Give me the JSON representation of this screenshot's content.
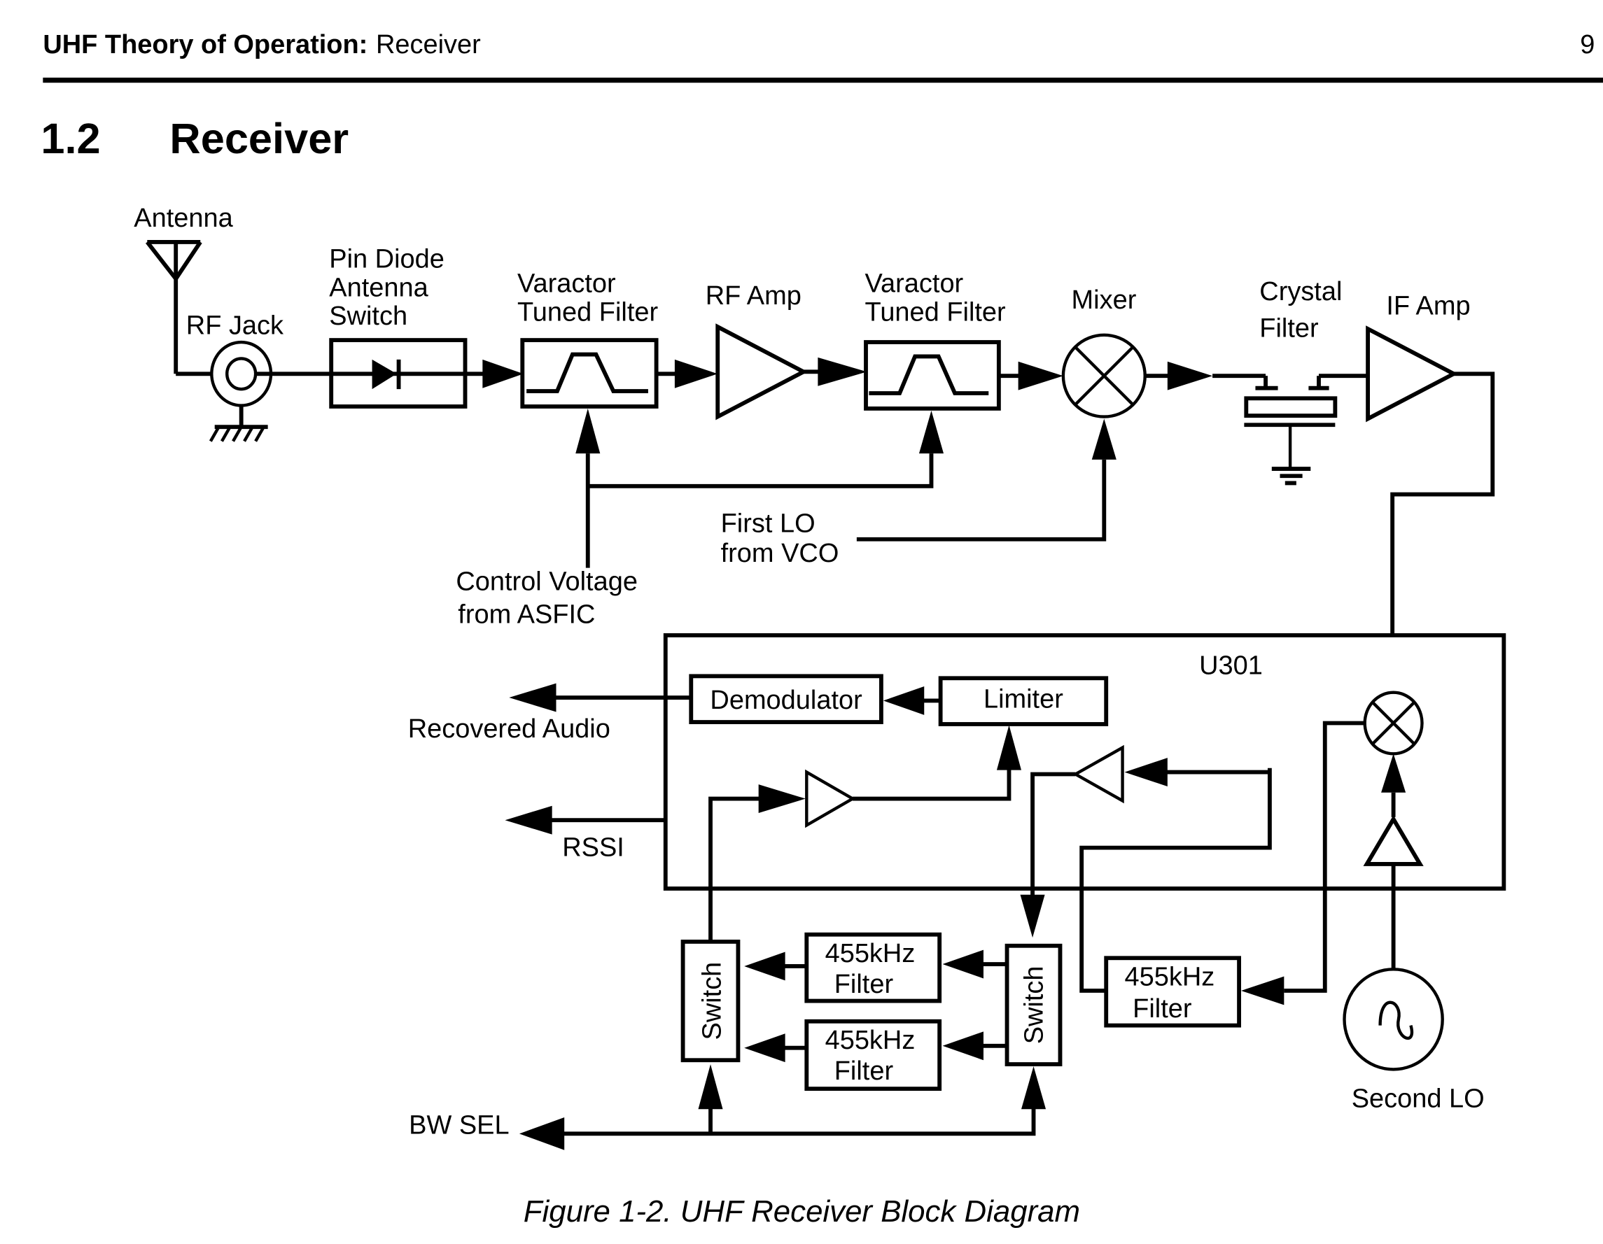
{
  "header": {
    "section_label": "UHF Theory of Operation:",
    "section_name": "Receiver",
    "page_number": "9"
  },
  "section": {
    "number": "1.2",
    "title": "Receiver"
  },
  "diagram": {
    "antenna": "Antenna",
    "rf_jack": "RF Jack",
    "pin_diode": [
      "Pin Diode",
      "Antenna",
      "Switch"
    ],
    "varactor1": [
      "Varactor",
      "Tuned Filter"
    ],
    "rf_amp": "RF Amp",
    "varactor2": [
      "Varactor",
      "Tuned Filter"
    ],
    "mixer": "Mixer",
    "crystal_filter": [
      "Crystal",
      "Filter"
    ],
    "if_amp": "IF Amp",
    "first_lo": [
      "First LO",
      "from VCO"
    ],
    "control_voltage": [
      "Control Voltage",
      "from ASFIC"
    ],
    "u301": "U301",
    "demodulator": "Demodulator",
    "limiter": "Limiter",
    "recovered_audio": "Recovered Audio",
    "rssi": "RSSI",
    "filter_455_label": [
      "455kHz",
      "Filter"
    ],
    "switch_label": "Switch",
    "second_lo": "Second LO",
    "bw_sel": "BW SEL"
  },
  "caption": "Figure 1-2.  UHF Receiver Block Diagram"
}
